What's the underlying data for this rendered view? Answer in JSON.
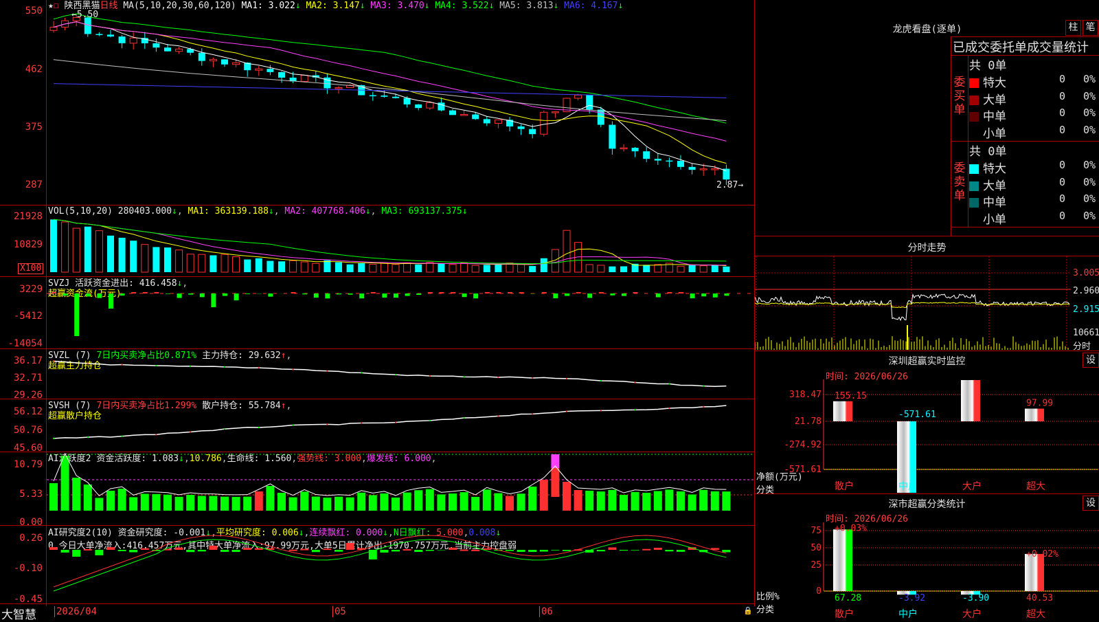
{
  "stock": {
    "name": "陕西黑猫",
    "period": "日线"
  },
  "kline": {
    "ma_label": "MA(5,10,20,30,60,120)",
    "ma_values": [
      {
        "name": "MA1",
        "value": "3.022",
        "color": "#ffffff"
      },
      {
        "name": "MA2",
        "value": "3.147",
        "color": "#ffff00"
      },
      {
        "name": "MA3",
        "value": "3.470",
        "color": "#ff40ff"
      },
      {
        "name": "MA4",
        "value": "3.522",
        "color": "#00ff00"
      },
      {
        "name": "MA5",
        "value": "3.813",
        "color": "#c0c0c0"
      },
      {
        "name": "MA6",
        "value": "4.167",
        "color": "#4040ff"
      }
    ],
    "y_labels": [
      "550",
      "462",
      "375",
      "287"
    ],
    "high_label": "5.50",
    "low_label": "2.87"
  },
  "vol": {
    "label": "VOL(5,10,20)",
    "value": "280403.000",
    "ma1": "363139.188",
    "ma2": "407768.406",
    "ma3": "693137.375",
    "y_labels": [
      "21928",
      "10829"
    ],
    "unit": "X100"
  },
  "svzj": {
    "label": "SVZJ",
    "title": "活跃资金进出:",
    "value": "416.458",
    "sub": "超赢资金流(万元)",
    "y_labels": [
      "3229",
      "-5412",
      "-14054"
    ]
  },
  "svzl": {
    "label": "SVZL (7)",
    "seg1": "7日内买卖净占比0.871%",
    "seg2": "主力持仓:",
    "value": "29.632",
    "sub": "超赢主力持仓",
    "y_labels": [
      "36.17",
      "32.71",
      "29.26"
    ]
  },
  "svsh": {
    "label": "SVSH (7)",
    "seg1": "7日内买卖净占比1.299%",
    "seg2": "散户持仓:",
    "value": "55.784",
    "sub": "超赢散户持仓",
    "y_labels": [
      "56.12",
      "50.76",
      "45.60"
    ]
  },
  "ai1": {
    "label": "AI活跃度2",
    "seg1": "资金活跃度:",
    "v1": "1.083",
    "v2": "10.786",
    "seg3": "生命线:",
    "v3": "1.560",
    "seg4": "强势线:",
    "v4": "3.000",
    "seg5": "爆发线:",
    "v5": "6.000",
    "y_labels": [
      "10.79",
      "5.33",
      "0.00"
    ]
  },
  "ai2": {
    "label": "AI研究度2(10)",
    "seg1": "资金研究度:",
    "v1": "-0.001",
    "seg2": "平均研究度:",
    "v2": "0.006",
    "seg3": "连续飘红:",
    "v3": "0.000",
    "seg4": "N日飘红:",
    "v4": "5.000",
    "v5": "0.008",
    "line2": "0,今日大单净流入:416.457万元,其中特大单净流入:97.99万元,大单5日累计净出-1970.757万元,当前主力控盘弱",
    "y_labels": [
      "0.26",
      "-0.10",
      "-0.45"
    ]
  },
  "xaxis": {
    "labels": [
      "2026/04",
      "05",
      "06"
    ],
    "brand": "大智慧"
  },
  "longhu": {
    "title": "龙虎看盘(逐单)",
    "btn1": "柱",
    "btn2": "笔",
    "header": "已成交委托单成交量统计",
    "buy": {
      "side": "委买单",
      "total": "共 0单",
      "rows": [
        {
          "label": "特大",
          "val": "0",
          "pct": "0%",
          "color": "#ff0000"
        },
        {
          "label": "大单",
          "val": "0",
          "pct": "0%",
          "color": "#a00000"
        },
        {
          "label": "中单",
          "val": "0",
          "pct": "0%",
          "color": "#600000"
        },
        {
          "label": "小单",
          "val": "0",
          "pct": "0%",
          "color": "#000000"
        }
      ]
    },
    "sell": {
      "side": "委卖单",
      "total": "共 0单",
      "rows": [
        {
          "label": "特大",
          "val": "0",
          "pct": "0%",
          "color": "#00ffff"
        },
        {
          "label": "大单",
          "val": "0",
          "pct": "0%",
          "color": "#008888"
        },
        {
          "label": "中单",
          "val": "0",
          "pct": "0%",
          "color": "#006666"
        },
        {
          "label": "小单",
          "val": "0",
          "pct": "0%",
          "color": "#000000"
        }
      ]
    }
  },
  "fenshi": {
    "title": "分时走势",
    "y_labels": [
      "3.005",
      "2.960",
      "2.915"
    ],
    "vol_label": "10661",
    "foot": "分时"
  },
  "monitor": {
    "title": "深圳超赢实时监控",
    "btn": "设",
    "time": "时间: 2026/06/26",
    "y_labels": [
      "318.47",
      "21.78",
      "-274.92",
      "-571.61"
    ],
    "axis_title1": "净额(万元)",
    "axis_title2": "分类",
    "bars": [
      {
        "cat": "散户",
        "value": 155.15,
        "label": "155.15"
      },
      {
        "cat": "中户",
        "value": -571.61,
        "label": "-571.61"
      },
      {
        "cat": "大户",
        "value": 318.47,
        "label": "318.47"
      },
      {
        "cat": "超大",
        "value": 97.99,
        "label": "97.99"
      }
    ]
  },
  "classify": {
    "title": "深市超赢分类统计",
    "btn": "设",
    "time": "时间: 2026/06/26",
    "y_labels": [
      "75",
      "50",
      "25",
      "0"
    ],
    "axis_title1": "比例%",
    "axis_title2": "分类",
    "bars": [
      {
        "cat": "散户",
        "value": 67.28,
        "label": "67.28",
        "top": "+0.03%"
      },
      {
        "cat": "中户",
        "value": -3.92,
        "label": "-3.92",
        "top": ""
      },
      {
        "cat": "大户",
        "value": -3.9,
        "label": "-3.90",
        "top": ""
      },
      {
        "cat": "超大",
        "value": 40.53,
        "label": "40.53",
        "top": "+0.02%"
      }
    ]
  }
}
